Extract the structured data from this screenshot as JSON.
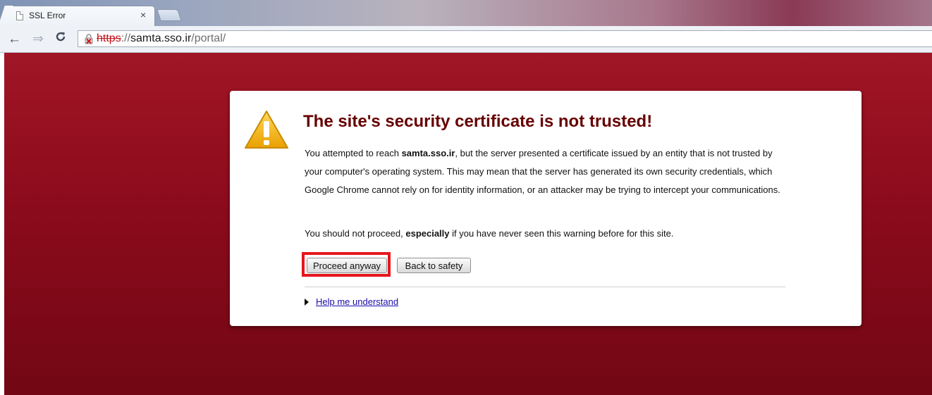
{
  "browser": {
    "tab": {
      "title": "SSL Error",
      "close_glyph": "×"
    },
    "toolbar": {
      "back_glyph": "←",
      "forward_glyph": "⇒",
      "url_scheme": "https",
      "url_separator": "://",
      "url_host": "samta.sso.ir",
      "url_path": "/portal/"
    }
  },
  "warning": {
    "title": "The site's security certificate is not trusted!",
    "body_before_host": "You attempted to reach ",
    "body_host": "samta.sso.ir",
    "body_after_host": ", but the server presented a certificate issued by an entity that is not trusted by your computer's operating system. This may mean that the server has generated its own security credentials, which Google Chrome cannot rely on for identity information, or an attacker may be trying to intercept your communications.",
    "advice_before": "You should not proceed, ",
    "advice_emphasis": "especially",
    "advice_after": " if you have never seen this warning before for this site.",
    "proceed_label": "Proceed anyway",
    "back_label": "Back to safety",
    "help_label": "Help me understand"
  },
  "icons": {
    "tab": "page-icon",
    "reload": "reload-icon",
    "security": "broken-lock-icon",
    "warning": "warning-triangle-icon",
    "expand": "triangle-right-icon"
  },
  "colors": {
    "background": "#8b0b1c",
    "title": "#660000",
    "highlight": "#e6161e",
    "link": "#1a0dab",
    "scheme_error": "#c0141a"
  }
}
